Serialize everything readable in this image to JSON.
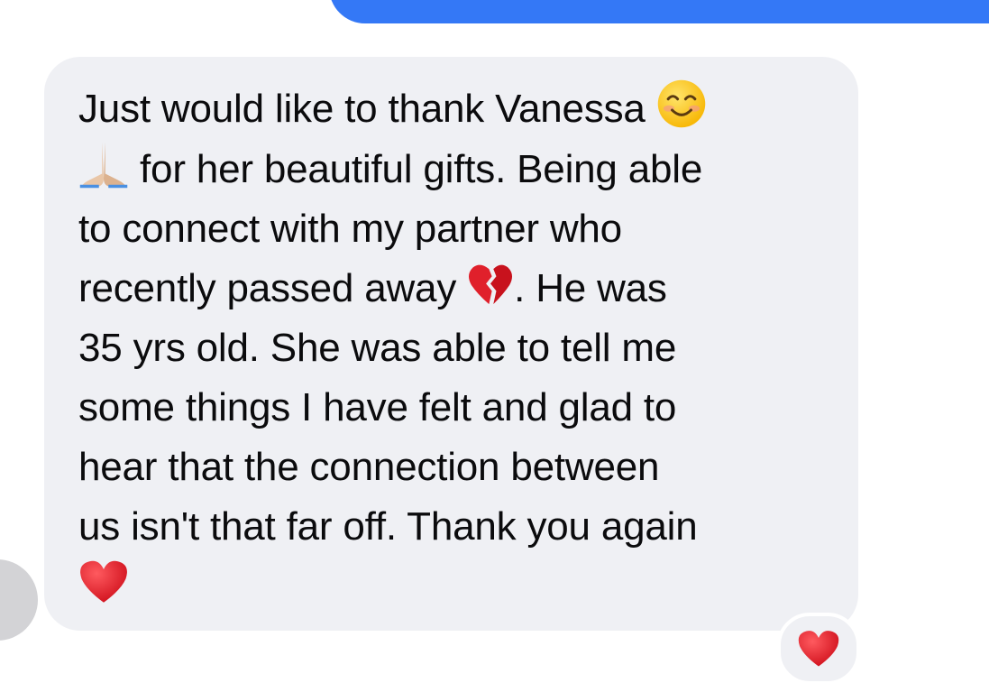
{
  "message": {
    "lines": [
      "Just would like to thank Vanessa",
      "for her beautiful gifts. Being able",
      "to connect with my partner who",
      "recently passed away",
      ". He was",
      "35 yrs old. She was able to tell me",
      "some things I have felt and glad to",
      "hear that the connection between",
      "us isn't that far off.  Thank you again"
    ],
    "emojis": {
      "smile": "smiling-face-icon",
      "pray": "folded-hands-icon",
      "broken_heart": "broken-heart-icon",
      "heart": "red-heart-icon"
    }
  },
  "reaction": {
    "icon": "red-heart-icon"
  },
  "colors": {
    "outgoing_bubble": "#3478f6",
    "incoming_bubble": "#eff0f4",
    "heart": "#e0202b"
  }
}
